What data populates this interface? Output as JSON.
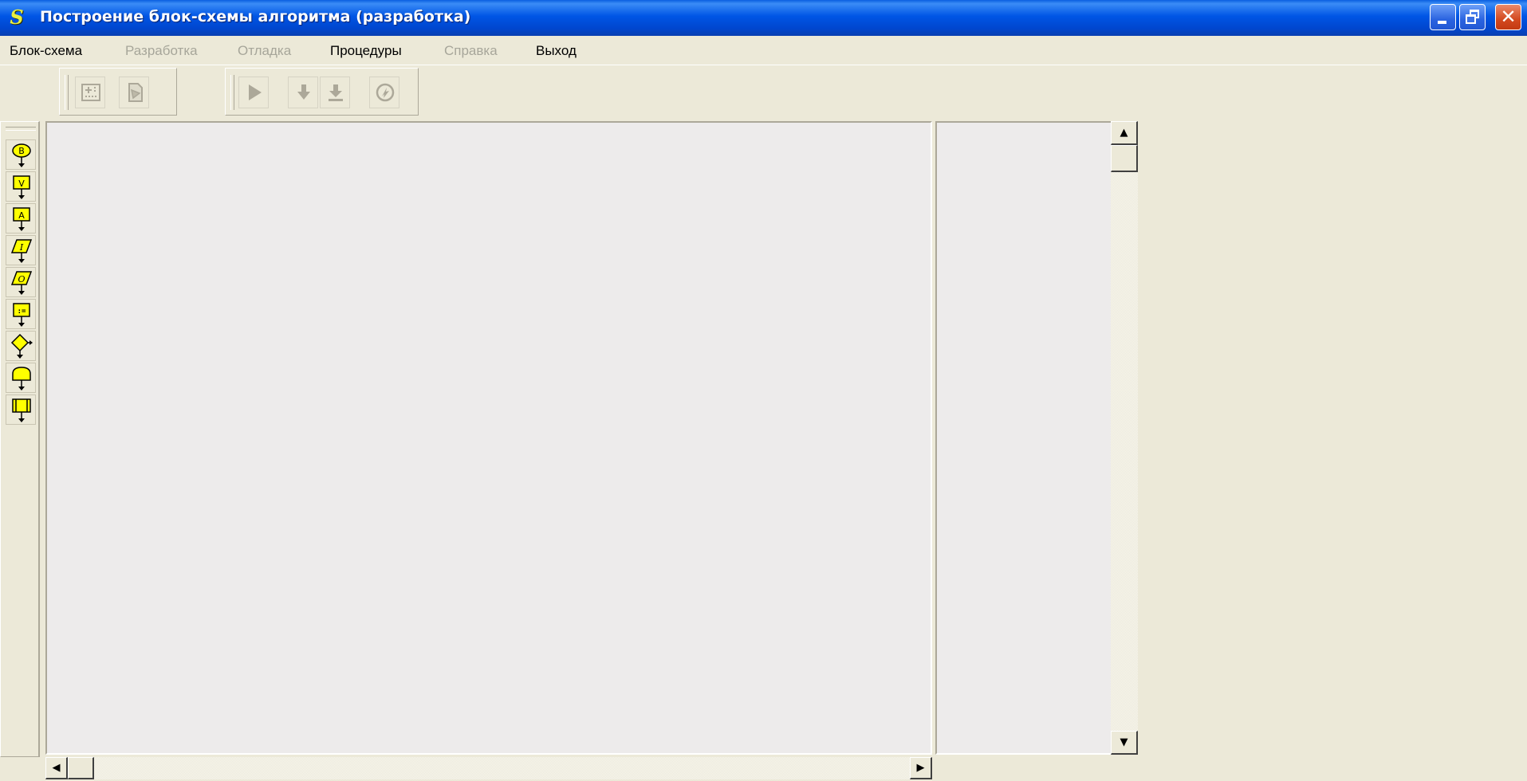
{
  "window": {
    "title": "Построение блок-схемы алгоритма (разработка)",
    "app_icon": "S",
    "controls": [
      "minimize-icon",
      "restore-icon",
      "close-icon"
    ]
  },
  "menu": {
    "items": [
      {
        "label": "Блок-схема",
        "enabled": true
      },
      {
        "label": "Разработка",
        "enabled": false
      },
      {
        "label": "Отладка",
        "enabled": false
      },
      {
        "label": "Процедуры",
        "enabled": true
      },
      {
        "label": "Справка",
        "enabled": false
      },
      {
        "label": "Выход",
        "enabled": true
      }
    ]
  },
  "toolbar": {
    "group1": [
      "connect-lines-icon",
      "document-icon"
    ],
    "group2": [
      "run-icon",
      "step-into-icon",
      "step-over-icon",
      "stop-icon"
    ],
    "enabled": false
  },
  "palette": {
    "blocks": [
      {
        "icon": "begin-block-icon",
        "letter": "B"
      },
      {
        "icon": "variables-block-icon",
        "letter": "V"
      },
      {
        "icon": "action-block-icon",
        "letter": "A"
      },
      {
        "icon": "input-block-icon",
        "letter": "I"
      },
      {
        "icon": "output-block-icon",
        "letter": "O"
      },
      {
        "icon": "assignment-block-icon",
        "letter": ":="
      },
      {
        "icon": "decision-block-icon",
        "letter": ""
      },
      {
        "icon": "loop-block-icon",
        "letter": ""
      },
      {
        "icon": "procedure-block-icon",
        "letter": ""
      }
    ],
    "fill_color": "#FFFF00"
  },
  "colors": {
    "titlebar": "#0055E5",
    "chrome": "#ECE9D8",
    "canvas": "#EDEBEB"
  }
}
